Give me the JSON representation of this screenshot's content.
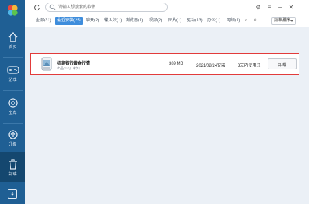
{
  "search": {
    "placeholder": "请输入想搜索的软件"
  },
  "window": {
    "settings": "⚙",
    "menu": "≡",
    "minimize": "─",
    "close": "✕"
  },
  "sidebar": {
    "items": [
      {
        "label": "首页",
        "icon": "home-icon"
      },
      {
        "label": "游戏",
        "icon": "gamepad-icon"
      },
      {
        "label": "宝库",
        "icon": "treasure-icon"
      },
      {
        "label": "升级",
        "icon": "upgrade-icon"
      },
      {
        "label": "卸载",
        "icon": "trash-icon"
      }
    ]
  },
  "tabs": [
    {
      "label": "全部(31)"
    },
    {
      "label": "最近安装(25)"
    },
    {
      "label": "聊天(2)"
    },
    {
      "label": "输入法(1)"
    },
    {
      "label": "浏览器(1)"
    },
    {
      "label": "视频(2)"
    },
    {
      "label": "图片(1)"
    },
    {
      "label": "驱动(13)"
    },
    {
      "label": "办公(1)"
    },
    {
      "label": "网络(1)"
    }
  ],
  "tabs_more": "0",
  "sort": {
    "label": "频率排序"
  },
  "app": {
    "name": "招商银行黄金行情",
    "publisher": "出品公司: 未知",
    "size": "389 MB",
    "date": "2021/02/24安装",
    "last_used": "3天内使用过",
    "action": "卸载"
  },
  "colors": {
    "sidebar": "#1f5f94",
    "sidebar_active": "#14476f",
    "accent": "#3e8ddc",
    "highlight": "#e23b3b"
  }
}
